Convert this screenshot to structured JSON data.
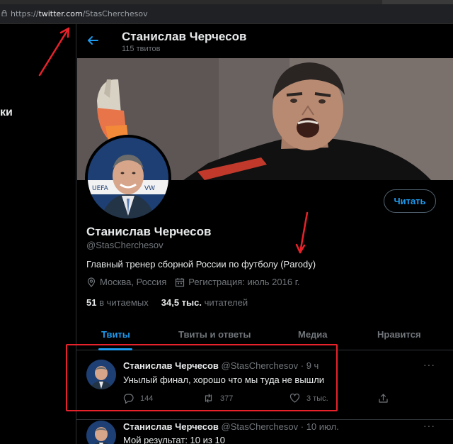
{
  "browser": {
    "url_scheme": "https://",
    "url_host": "twitter.com",
    "url_path": "/StasCherchesov"
  },
  "sidebar": {
    "fragment": "ки"
  },
  "header": {
    "name": "Станислав Черчесов",
    "tweet_count": "115 твитов"
  },
  "profile": {
    "name": "Станислав Черчесов",
    "handle": "@StasCherchesov",
    "bio": "Главный тренер сборной России по футболу (Parody)",
    "location": "Москва, Россия",
    "joined": "Регистрация: июль 2016 г.",
    "following_count": "51",
    "following_label": "в читаемых",
    "followers_count": "34,5 тыс.",
    "followers_label": "читателей",
    "follow_button": "Читать"
  },
  "tabs": [
    {
      "label": "Твиты",
      "active": true
    },
    {
      "label": "Твиты и ответы",
      "active": false
    },
    {
      "label": "Медиа",
      "active": false
    },
    {
      "label": "Нравится",
      "active": false
    }
  ],
  "tweets": [
    {
      "name": "Станислав Черчесов",
      "handle": "@StasCherchesov",
      "time": "9 ч",
      "text": "Унылый финал, хорошо что мы туда не вышли",
      "replies": "144",
      "retweets": "377",
      "likes": "3 тыс."
    },
    {
      "name": "Станислав Черчесов",
      "handle": "@StasCherchesov",
      "time": "10 июл.",
      "text": "Мой результат: 10 из 10"
    }
  ],
  "colors": {
    "accent": "#1d9bf0",
    "annotation": "#e8222a",
    "background": "#000000",
    "muted": "#71767b"
  }
}
